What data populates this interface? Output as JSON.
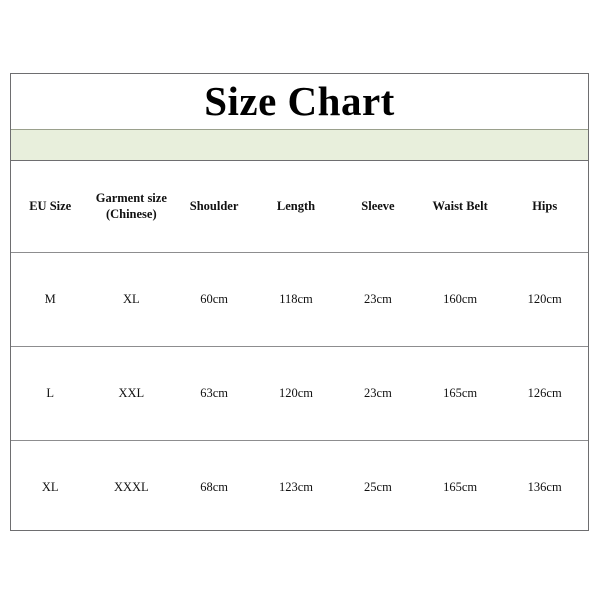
{
  "document": {
    "title": "Size Chart",
    "accent_color": "#e8efdc",
    "border_color": "#6e6e70",
    "text_color": "#111111",
    "background_color": "#ffffff"
  },
  "table": {
    "headers": [
      {
        "key": "eu_size",
        "label": "EU Size",
        "line1": "EU Size",
        "line2": ""
      },
      {
        "key": "garment_size",
        "label": "Garment size (Chinese)",
        "line1": "Garment size",
        "line2": "(Chinese)"
      },
      {
        "key": "shoulder",
        "label": "Shoulder",
        "line1": "Shoulder",
        "line2": ""
      },
      {
        "key": "length",
        "label": "Length",
        "line1": "Length",
        "line2": ""
      },
      {
        "key": "sleeve",
        "label": "Sleeve",
        "line1": "Sleeve",
        "line2": ""
      },
      {
        "key": "waist_belt",
        "label": "Waist Belt",
        "line1": "Waist Belt",
        "line2": ""
      },
      {
        "key": "hips",
        "label": "Hips",
        "line1": "Hips",
        "line2": ""
      }
    ],
    "rows": [
      {
        "eu_size": "M",
        "garment_size": "XL",
        "shoulder": "60cm",
        "length": "118cm",
        "sleeve": "23cm",
        "waist_belt": "160cm",
        "hips": "120cm"
      },
      {
        "eu_size": "L",
        "garment_size": "XXL",
        "shoulder": "63cm",
        "length": "120cm",
        "sleeve": "23cm",
        "waist_belt": "165cm",
        "hips": "126cm"
      },
      {
        "eu_size": "XL",
        "garment_size": "XXXL",
        "shoulder": "68cm",
        "length": "123cm",
        "sleeve": "25cm",
        "waist_belt": "165cm",
        "hips": "136cm"
      }
    ]
  }
}
